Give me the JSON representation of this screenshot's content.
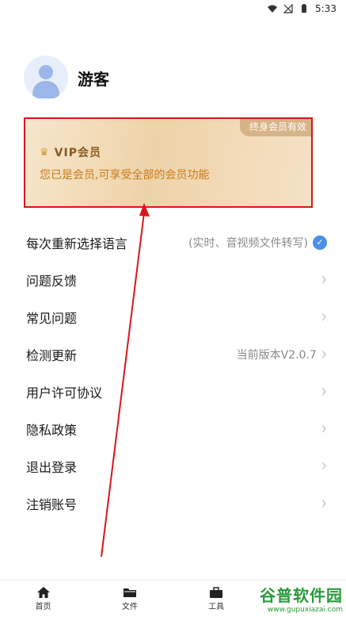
{
  "status_bar": {
    "time": "5:33",
    "icons": [
      "wifi-icon",
      "signal-off-icon",
      "battery-icon"
    ]
  },
  "profile": {
    "username": "游客",
    "avatar_icon": "user-avatar-icon"
  },
  "vip_card": {
    "badge": "终身会员有效",
    "title": "VIP会员",
    "description": "您已是会员,可享受全部的会员功能",
    "crown_icon": "crown-icon"
  },
  "menu": {
    "items": [
      {
        "label": "每次重新选择语言",
        "value": "(实时、音视频文件转写)",
        "accessory": "check"
      },
      {
        "label": "问题反馈",
        "value": "",
        "accessory": "chevron"
      },
      {
        "label": "常见问题",
        "value": "",
        "accessory": "chevron"
      },
      {
        "label": "检测更新",
        "value": "当前版本V2.0.7",
        "accessory": "chevron"
      },
      {
        "label": "用户许可协议",
        "value": "",
        "accessory": "chevron"
      },
      {
        "label": "隐私政策",
        "value": "",
        "accessory": "chevron"
      },
      {
        "label": "退出登录",
        "value": "",
        "accessory": "chevron"
      },
      {
        "label": "注销账号",
        "value": "",
        "accessory": "chevron"
      }
    ]
  },
  "tabbar": {
    "tabs": [
      {
        "label": "首页",
        "icon": "home-icon"
      },
      {
        "label": "文件",
        "icon": "folder-icon"
      },
      {
        "label": "工具",
        "icon": "briefcase-icon"
      }
    ]
  },
  "watermark": {
    "main": "谷普软件园",
    "sub": "www.gupuxiazai.com"
  },
  "colors": {
    "accent_red": "#d9161c",
    "vip_text": "#c87a1c",
    "check_blue": "#4a90ea"
  }
}
